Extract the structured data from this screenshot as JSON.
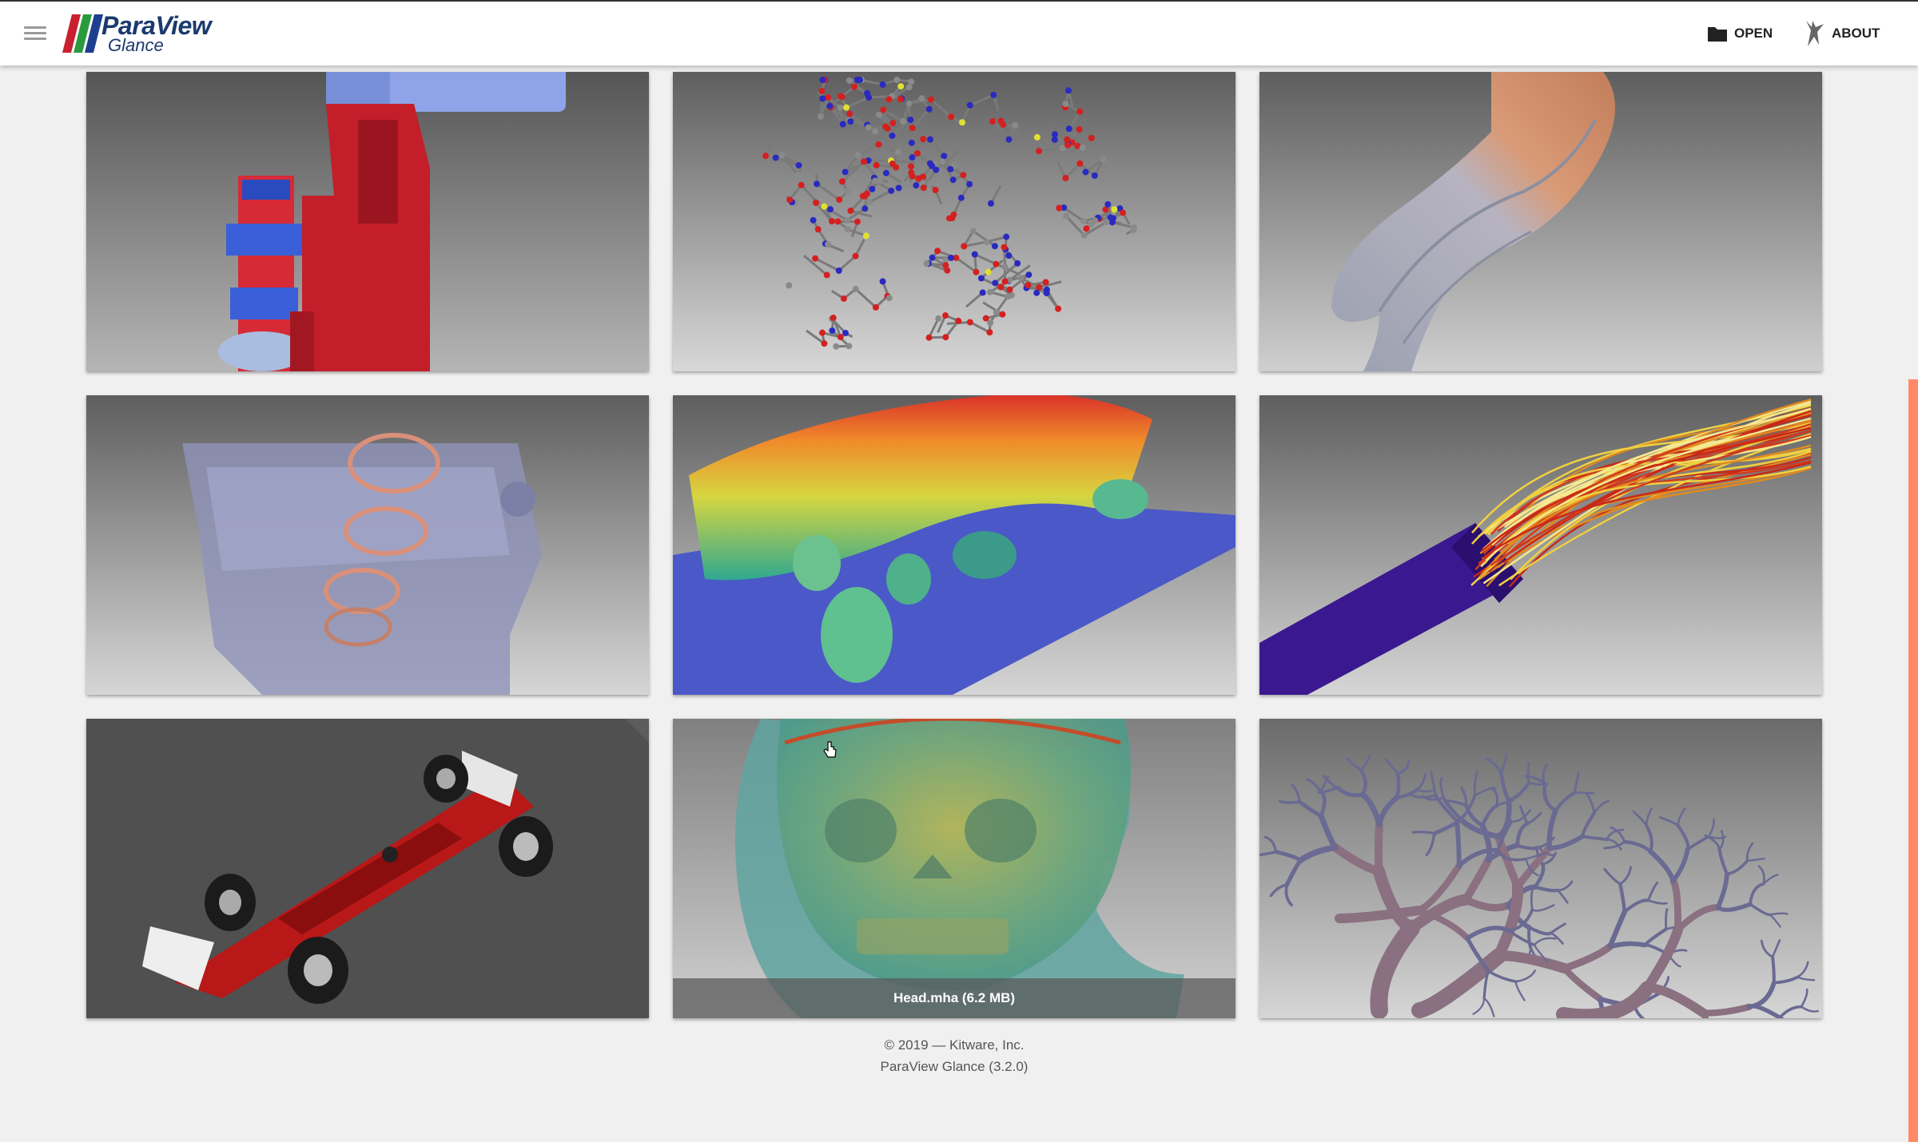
{
  "app": {
    "logo_main": "ParaView",
    "logo_sub": "Glance",
    "logo_colors": [
      "#c8202f",
      "#2b9a3e",
      "#1e3f8f"
    ]
  },
  "toolbar": {
    "open_label": "OPEN",
    "about_label": "ABOUT"
  },
  "samples": [
    {
      "id": "mechanical-clamp",
      "label": ""
    },
    {
      "id": "molecule",
      "label": ""
    },
    {
      "id": "tooth",
      "label": ""
    },
    {
      "id": "engine-block",
      "label": ""
    },
    {
      "id": "lidar-trees",
      "label": ""
    },
    {
      "id": "streamlines",
      "label": ""
    },
    {
      "id": "f1-car",
      "label": ""
    },
    {
      "id": "head",
      "label": "Head.mha (6.2 MB)"
    },
    {
      "id": "blood-vessels",
      "label": ""
    }
  ],
  "footer": {
    "copyright": "© 2019 — Kitware, Inc.",
    "version": "ParaView Glance (3.2.0)"
  },
  "colors": {
    "accent": "#ff8a65",
    "header_bg": "#ffffff",
    "page_bg": "#f0f0f0"
  }
}
